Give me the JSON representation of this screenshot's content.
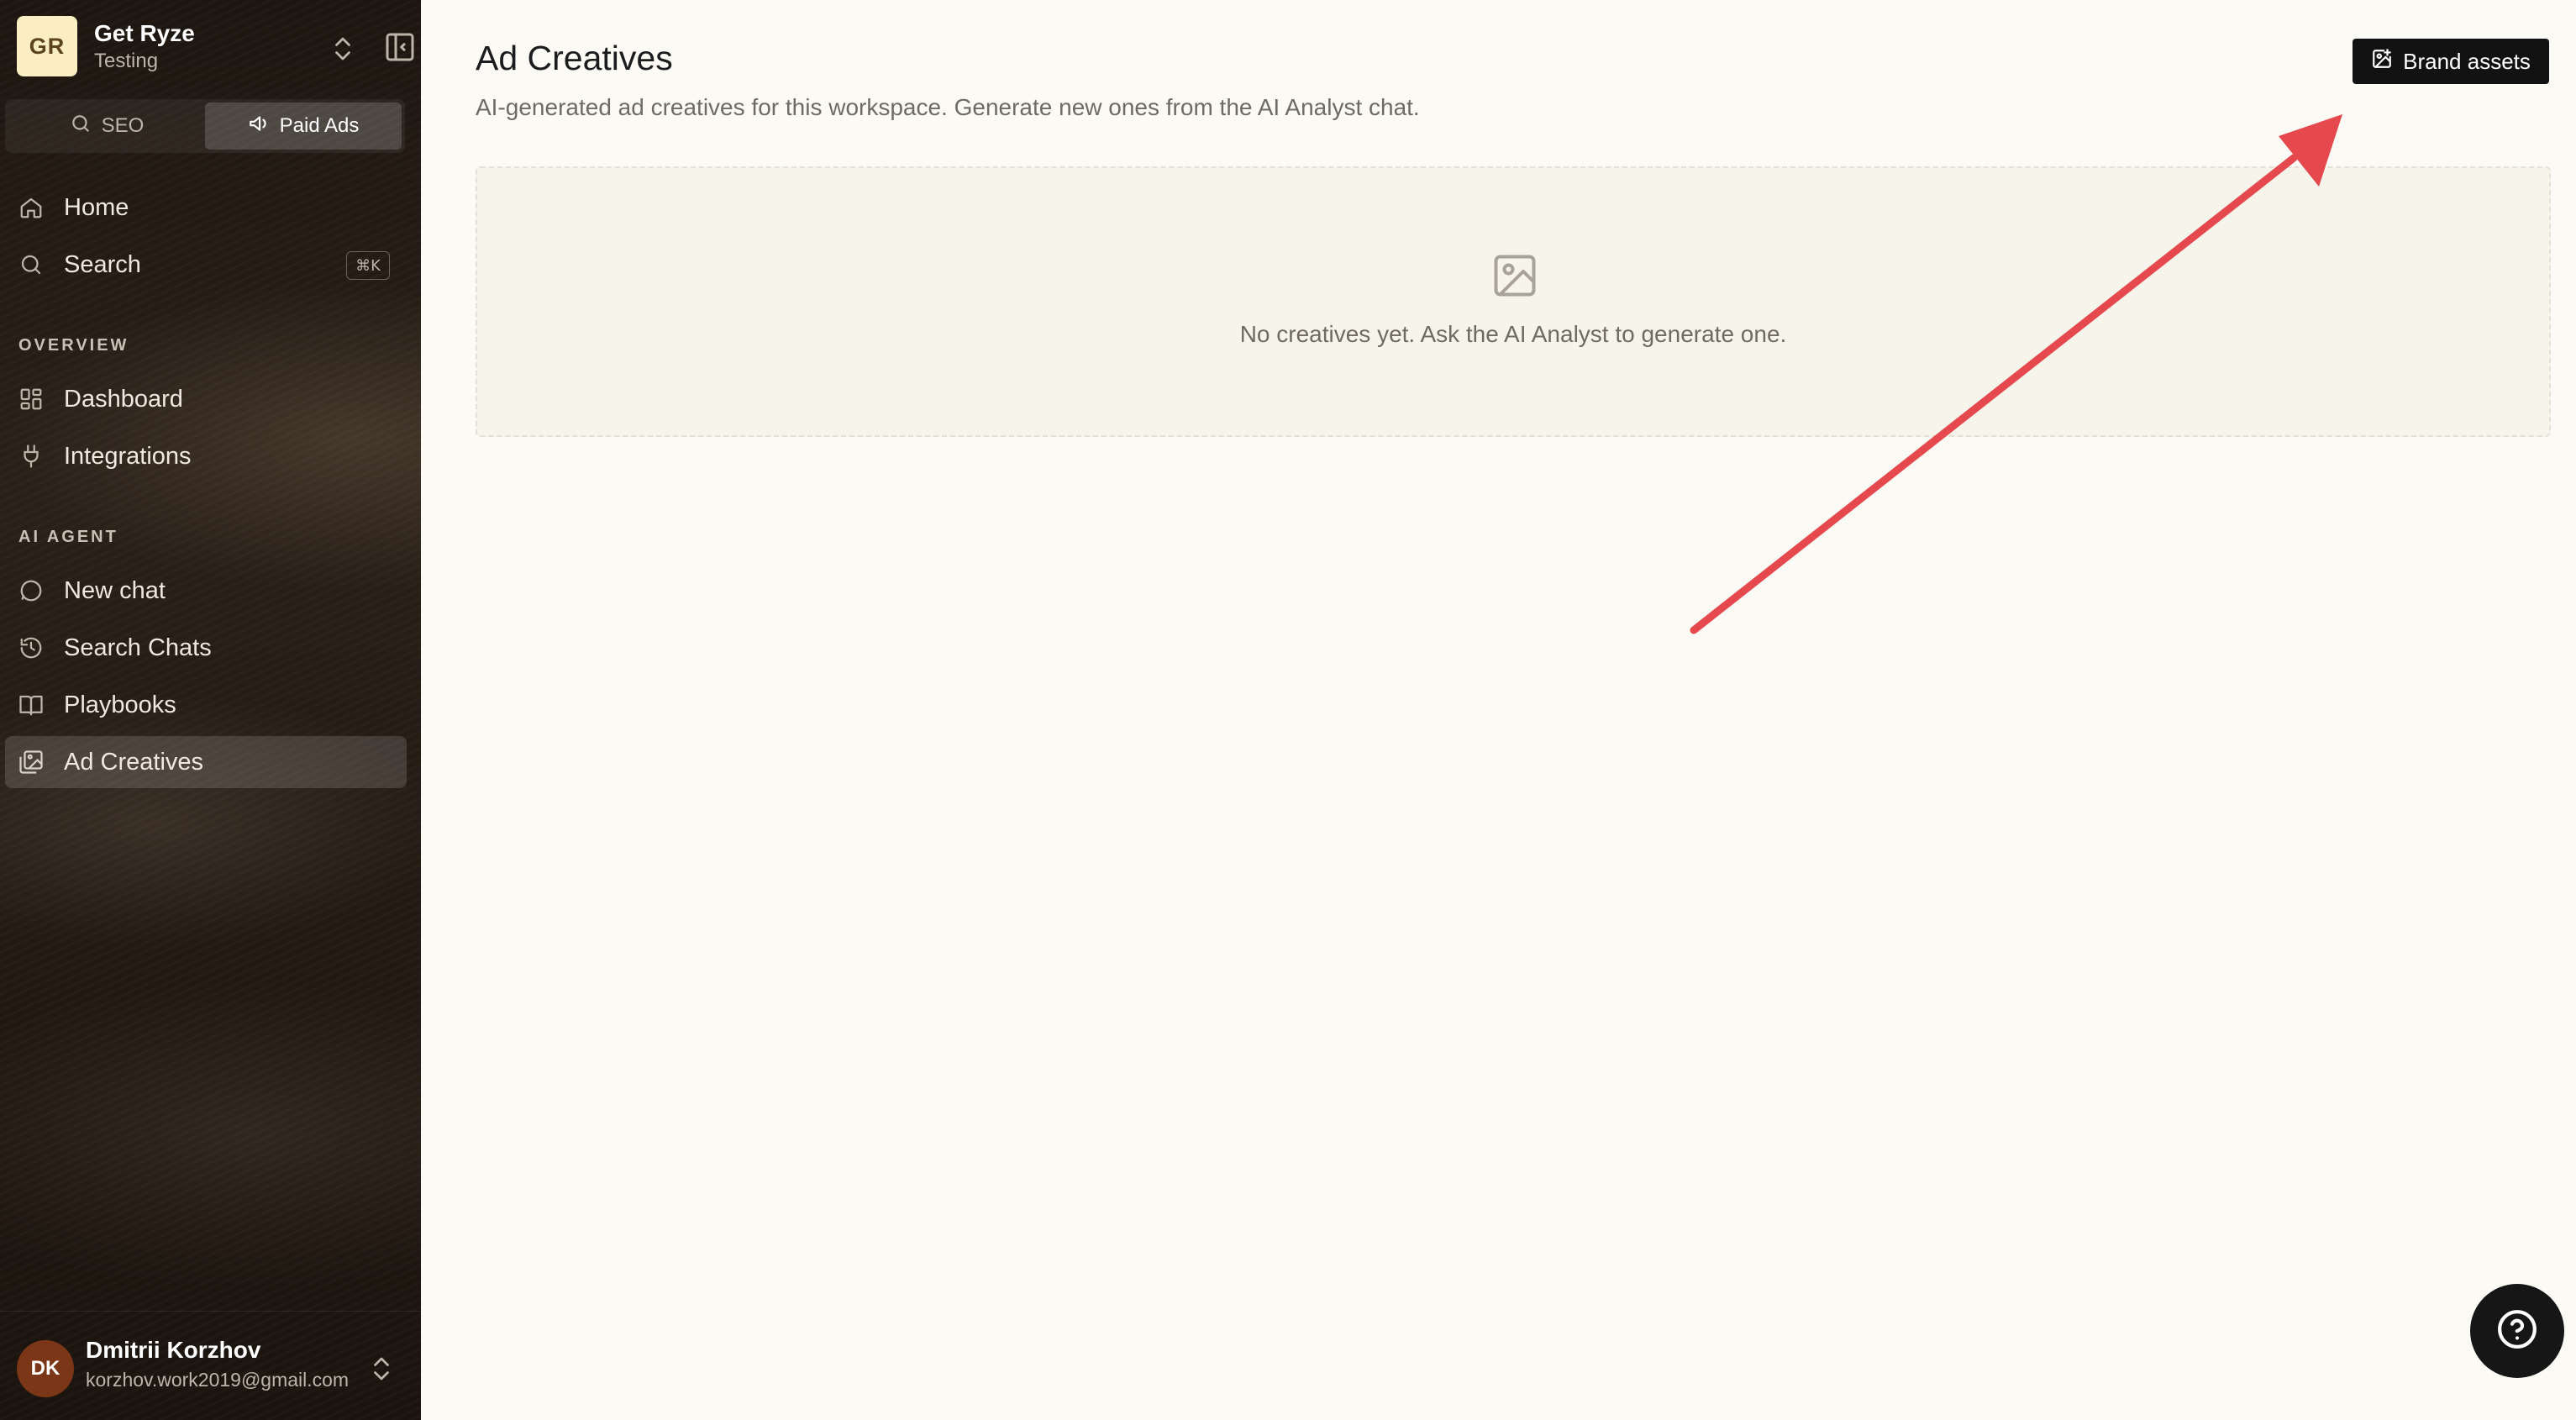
{
  "workspace": {
    "initials": "GR",
    "name": "Get Ryze",
    "subtitle": "Testing"
  },
  "mode_tabs": [
    {
      "label": "SEO",
      "icon": "search-icon",
      "active": false
    },
    {
      "label": "Paid Ads",
      "icon": "megaphone-icon",
      "active": true
    }
  ],
  "nav": {
    "home": "Home",
    "search": "Search",
    "search_shortcut": "⌘K",
    "overview_label": "OVERVIEW",
    "dashboard": "Dashboard",
    "integrations": "Integrations",
    "ai_agent_label": "AI AGENT",
    "new_chat": "New chat",
    "search_chats": "Search Chats",
    "playbooks": "Playbooks",
    "ad_creatives": "Ad Creatives"
  },
  "user": {
    "initials": "DK",
    "name": "Dmitrii Korzhov",
    "email": "korzhov.work2019@gmail.com"
  },
  "main": {
    "title": "Ad Creatives",
    "subtitle": "AI-generated ad creatives for this workspace. Generate new ones from the AI Analyst chat.",
    "brand_assets_label": "Brand assets",
    "empty_message": "No creatives yet. Ask the AI Analyst to generate one."
  },
  "colors": {
    "annotation_arrow": "#e5484d",
    "primary_button": "#121212",
    "page_background": "#fcfaf4"
  }
}
